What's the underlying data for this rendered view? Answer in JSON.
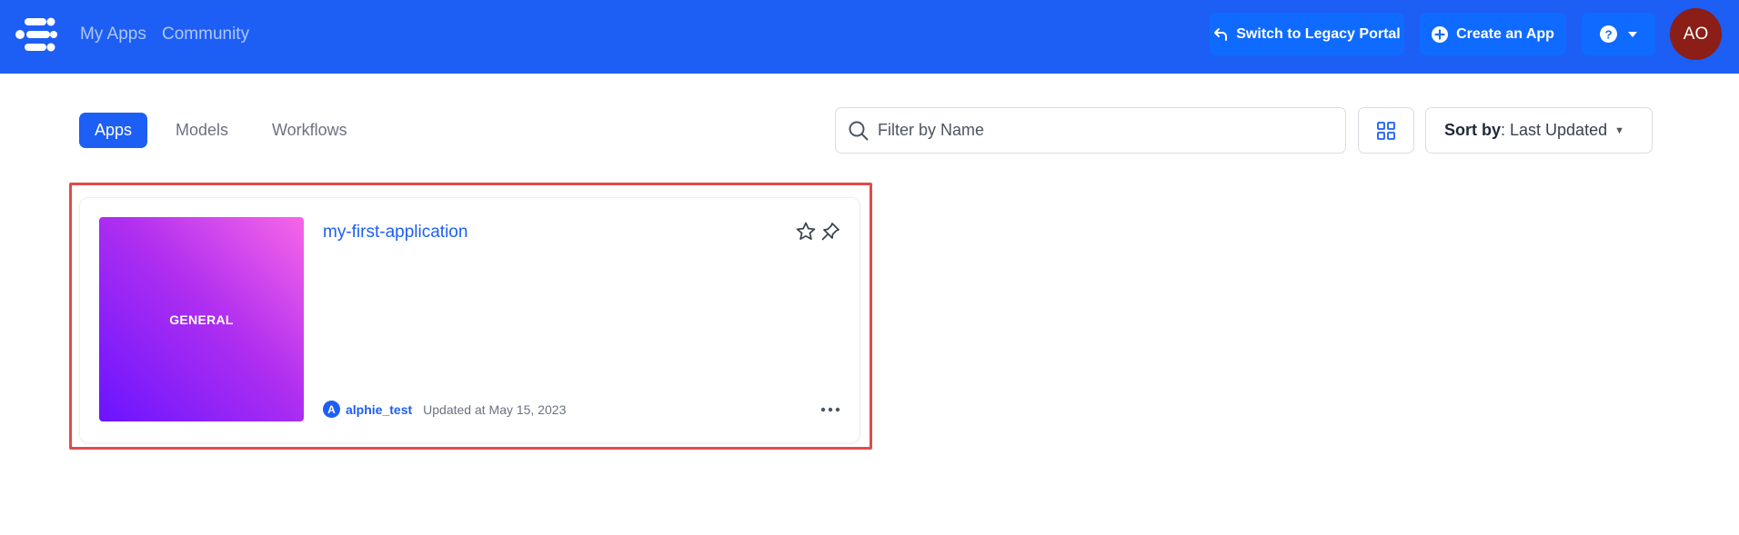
{
  "nav": {
    "logo_icon": "clarifai-logo-icon",
    "links": [
      "My Apps",
      "Community"
    ],
    "legacy_button": "Switch to Legacy Portal",
    "create_button": "Create an App",
    "help_icon": "question-circle-icon",
    "avatar_initials": "AO"
  },
  "toolbar": {
    "tabs": [
      "Apps",
      "Models",
      "Workflows"
    ],
    "active_tab": "Apps",
    "search_placeholder": "Filter by Name",
    "view_icon": "grid-view-icon",
    "sort_label": "Sort by",
    "sort_value": ": Last Updated"
  },
  "apps": [
    {
      "title": "my-first-application",
      "thumbnail_label": "GENERAL",
      "owner_initial": "A",
      "owner": "alphie_test",
      "updated": "Updated at May 15, 2023"
    }
  ],
  "colors": {
    "primary": "#1d5ef5",
    "button": "#0f6bff",
    "avatar": "#8b1e16",
    "highlight": "#e14b4b"
  }
}
